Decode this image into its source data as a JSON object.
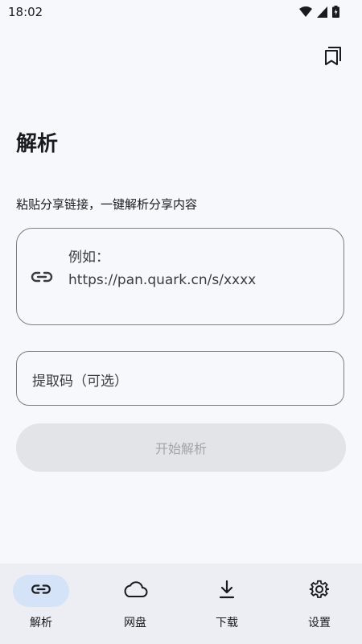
{
  "status_bar": {
    "time": "18:02",
    "icons": [
      "wifi-icon",
      "signal-icon",
      "battery-icon"
    ]
  },
  "header": {
    "action_icon": "bookmarks-icon"
  },
  "main": {
    "title": "解析",
    "hint": "粘贴分享链接，一键解析分享内容",
    "link_input": {
      "icon": "link-icon",
      "placeholder": "例如：\nhttps://pan.quark.cn/s/xxxx"
    },
    "code_input": {
      "placeholder": "提取码（可选）"
    },
    "start_button": "开始解析"
  },
  "bottom_nav": {
    "items": [
      {
        "label": "解析",
        "icon": "link-icon",
        "active": true
      },
      {
        "label": "网盘",
        "icon": "cloud-icon",
        "active": false
      },
      {
        "label": "下载",
        "icon": "download-icon",
        "active": false
      },
      {
        "label": "设置",
        "icon": "gear-icon",
        "active": false
      }
    ]
  },
  "colors": {
    "background": "#f7f8fc",
    "nav_background": "#eceef3",
    "active_pill": "#d4e3f7",
    "disabled_button": "#e3e4e8"
  }
}
